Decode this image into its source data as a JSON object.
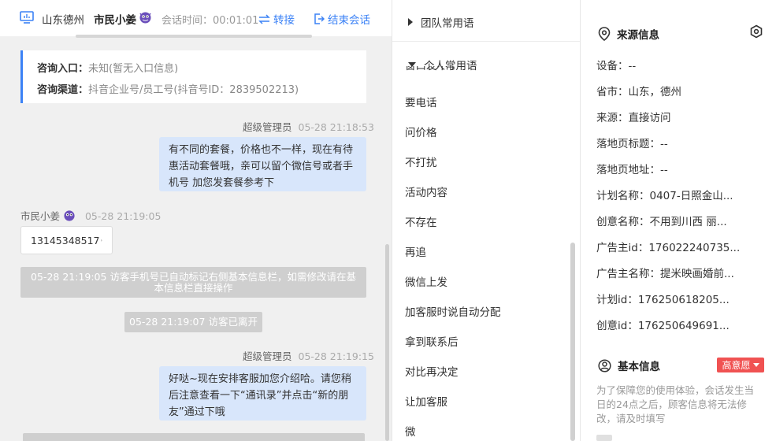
{
  "header": {
    "location": "山东德州",
    "visitor_name": "市民小姜",
    "session_time": "会话时间：00:01:01",
    "transfer_label": "转接",
    "end_label": "结束会话"
  },
  "consult_info": {
    "entry_label": "咨询入口：",
    "entry_value": "未知(暂无入口信息)",
    "channel_label": "咨询渠道：",
    "channel_value": "抖音企业号/员工号(抖音号ID：2839502213)"
  },
  "messages": [
    {
      "sender": "超级管理员",
      "time": "05-28 21:18:53",
      "lines": [
        "有不同的套餐，价格也不一样，现在有待",
        "惠活动套餐哦，亲可以留个微信号或者手",
        "机号 加您发套餐参考下"
      ]
    },
    {
      "sender": "市民小姜",
      "time": "05-28 21:19:05",
      "text": "13145348517"
    },
    {
      "system_lines": [
        "05-28 21:19:05 访客手机号已自动标记右侧基本信息栏，如需修改请在基",
        "本信息栏直接操作"
      ]
    },
    {
      "system": "05-28 21:19:07 访客已离开"
    },
    {
      "sender": "超级管理员",
      "time": "05-28 21:19:15",
      "lines": [
        "好哒~现在安排客服加您介绍哈。请您稍",
        "后注意查看一下“通讯录”并点击“新的朋",
        "友”通过下哦"
      ]
    }
  ],
  "phrases": {
    "team_group": "团队常用语",
    "personal_group": "个人常用语",
    "clipped_item": "窗口发不了",
    "items": [
      "要电话",
      "问价格",
      "不打扰",
      "活动内容",
      "不存在",
      "再追",
      "微信上发",
      "加客服时说自动分配",
      "拿到联系后",
      "对比再决定",
      "让加客服",
      "微"
    ]
  },
  "source_info": {
    "title": "来源信息",
    "fields": [
      "设备：--",
      "省市：山东，德州",
      "来源：直接访问",
      "落地页标题：--",
      "落地页地址：--",
      "计划名称：0407-日照金山...",
      "创意名称：不用到川西 丽...",
      "广告主id：176022240735...",
      "广告主名称：提米映画婚前...",
      "计划id：176250618205...",
      "创意id：176250649691..."
    ]
  },
  "basic_info": {
    "title": "基本信息",
    "intent_label": "高意愿",
    "notice": "为了保障您的使用体验，会话发生当日的24点之后，顾客信息将无法修改，请及时填写"
  },
  "colors": {
    "accent": "#3b82f6",
    "bubble": "#d8e6fb",
    "intent": "#f05252",
    "chat_bg": "#f0f0f0"
  }
}
